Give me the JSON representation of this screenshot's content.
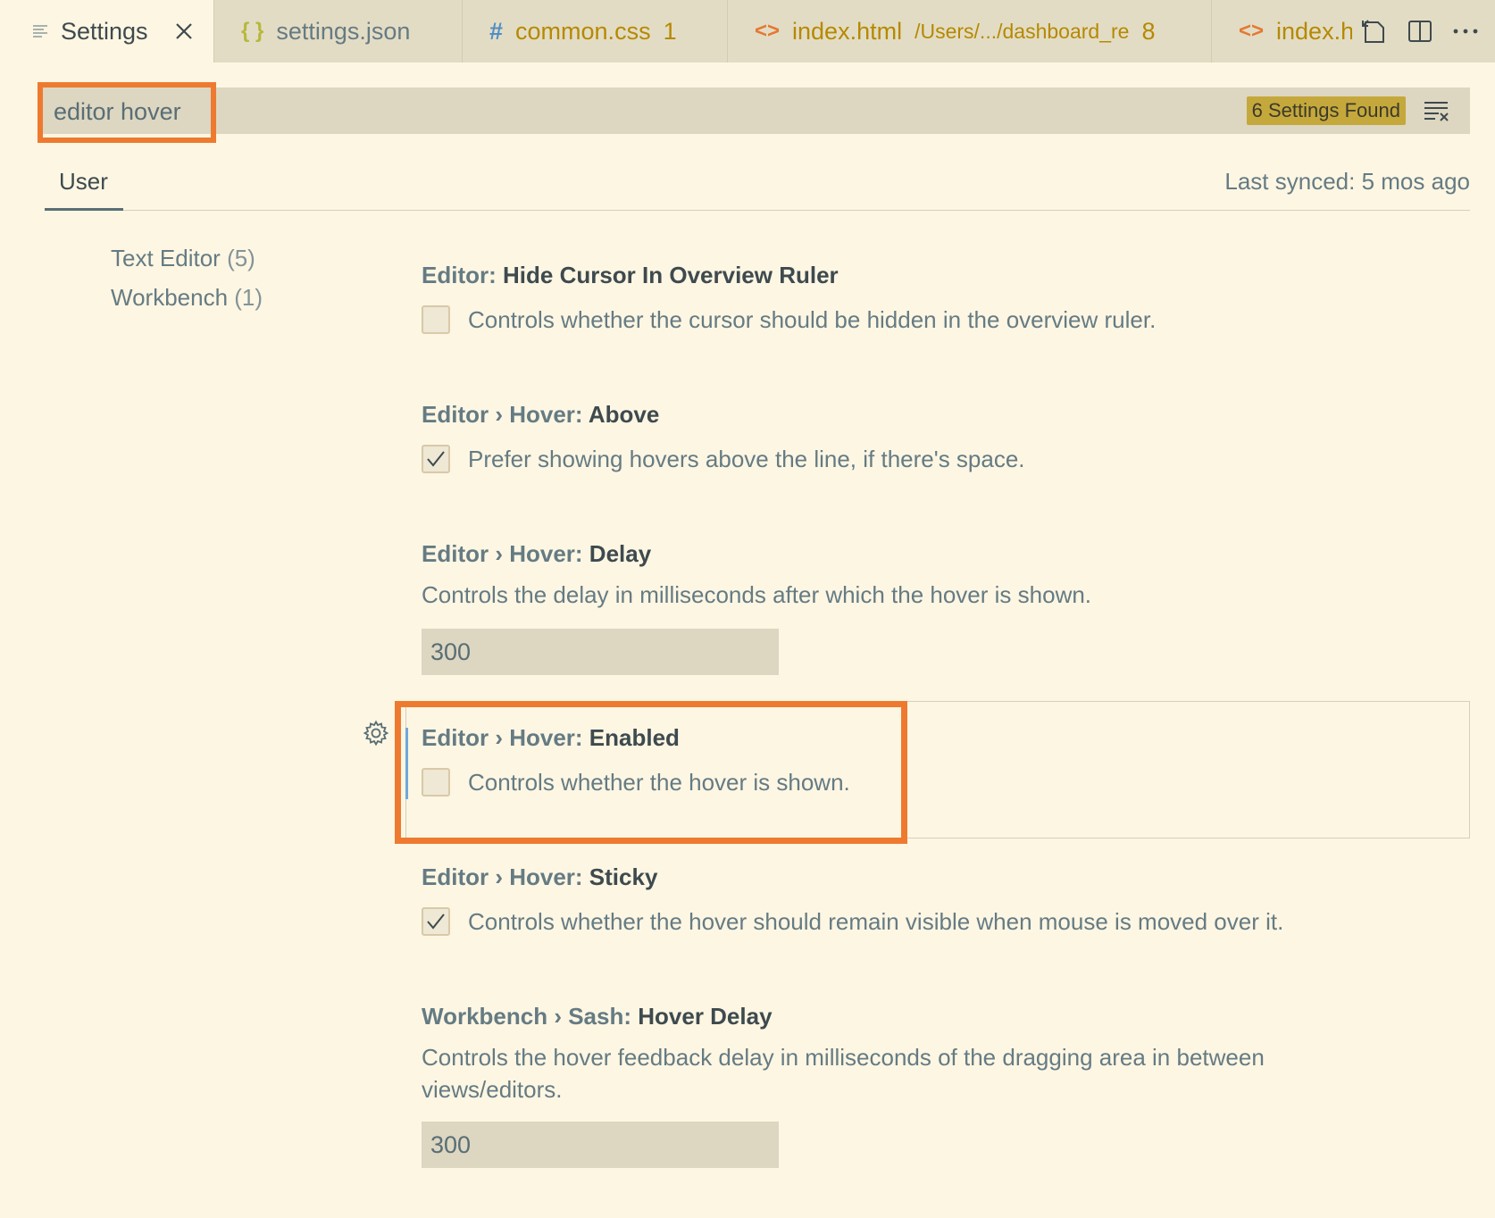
{
  "tabs": [
    {
      "label": "Settings",
      "icon": "settings-lines-icon"
    },
    {
      "label": "settings.json",
      "icon": "json-braces-icon"
    },
    {
      "label": "common.css",
      "dirty": "1",
      "icon": "css-hash-icon"
    },
    {
      "label": "index.html",
      "path": "/Users/.../dashboard_re",
      "dirty": "8",
      "icon": "html-brackets-icon"
    },
    {
      "label": "index.ht",
      "icon": "html-brackets-icon"
    }
  ],
  "search": {
    "value": "editor hover",
    "found": "6 Settings Found"
  },
  "scope": {
    "user": "User",
    "last_synced": "Last synced: 5 mos ago"
  },
  "toc": [
    {
      "label": "Text Editor",
      "count": "(5)"
    },
    {
      "label": "Workbench",
      "count": "(1)"
    }
  ],
  "settings": [
    {
      "category": "Editor: ",
      "name": "Hide Cursor In Overview Ruler",
      "description": "Controls whether the cursor should be hidden in the overview ruler.",
      "checked": false
    },
    {
      "category": "Editor › Hover: ",
      "name": "Above",
      "description": "Prefer showing hovers above the line, if there's space.",
      "checked": true
    },
    {
      "category": "Editor › Hover: ",
      "name": "Delay",
      "description": "Controls the delay in milliseconds after which the hover is shown.",
      "value": "300"
    },
    {
      "category": "Editor › Hover: ",
      "name": "Enabled",
      "description": "Controls whether the hover is shown.",
      "checked": false
    },
    {
      "category": "Editor › Hover: ",
      "name": "Sticky",
      "description": "Controls whether the hover should remain visible when mouse is moved over it.",
      "checked": true
    },
    {
      "category": "Workbench › Sash: ",
      "name": "Hover Delay",
      "description_line1": "Controls the hover feedback delay in milliseconds of the dragging area in between",
      "description_line2": "views/editors.",
      "value": "300"
    }
  ],
  "colors": {
    "accent_orange": "#ee7a30",
    "badge": "#c5a83c",
    "background": "#fdf6e3"
  }
}
